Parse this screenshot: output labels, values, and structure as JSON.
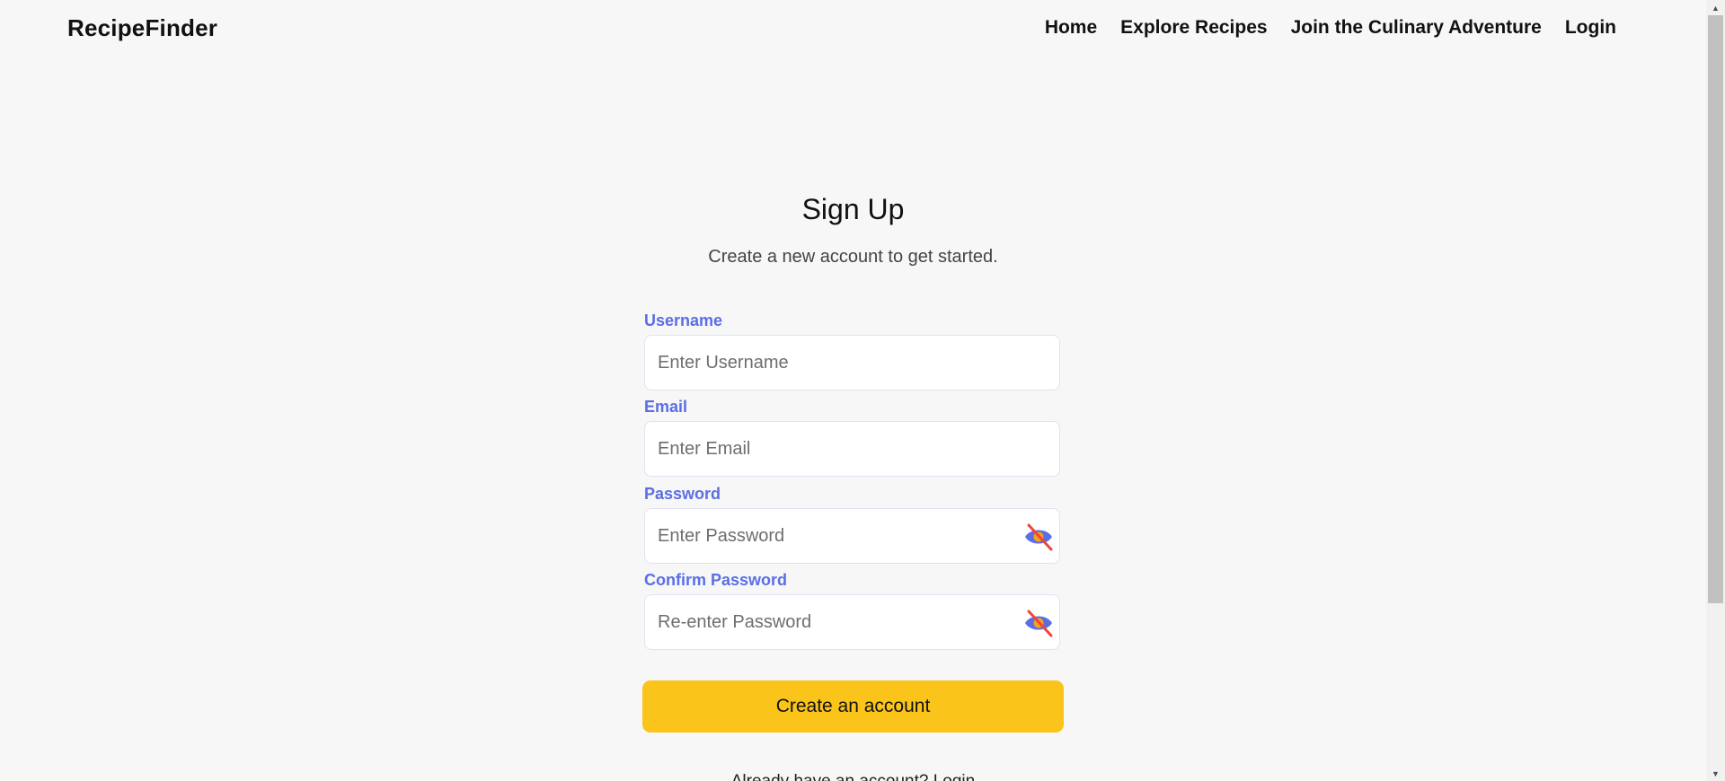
{
  "header": {
    "brand": "RecipeFinder",
    "nav": [
      {
        "label": "Home"
      },
      {
        "label": "Explore Recipes"
      },
      {
        "label": "Join the Culinary Adventure"
      },
      {
        "label": "Login"
      }
    ]
  },
  "form": {
    "title": "Sign Up",
    "subtitle": "Create a new account to get started.",
    "fields": [
      {
        "label": "Username",
        "placeholder": "Enter Username",
        "value": ""
      },
      {
        "label": "Email",
        "placeholder": "Enter Email",
        "value": ""
      },
      {
        "label": "Password",
        "placeholder": "Enter Password",
        "value": "",
        "toggle_icon": "eye-slash-icon"
      },
      {
        "label": "Confirm Password",
        "placeholder": "Re-enter Password",
        "value": "",
        "toggle_icon": "eye-slash-icon"
      }
    ],
    "submit_label": "Create an account",
    "footer_text": "Already have an account? Login"
  },
  "colors": {
    "accent_label": "#5a6ee6",
    "button": "#fbc41a",
    "eye_icon": "#5a6ee6",
    "eye_slash": "#f0453a"
  }
}
